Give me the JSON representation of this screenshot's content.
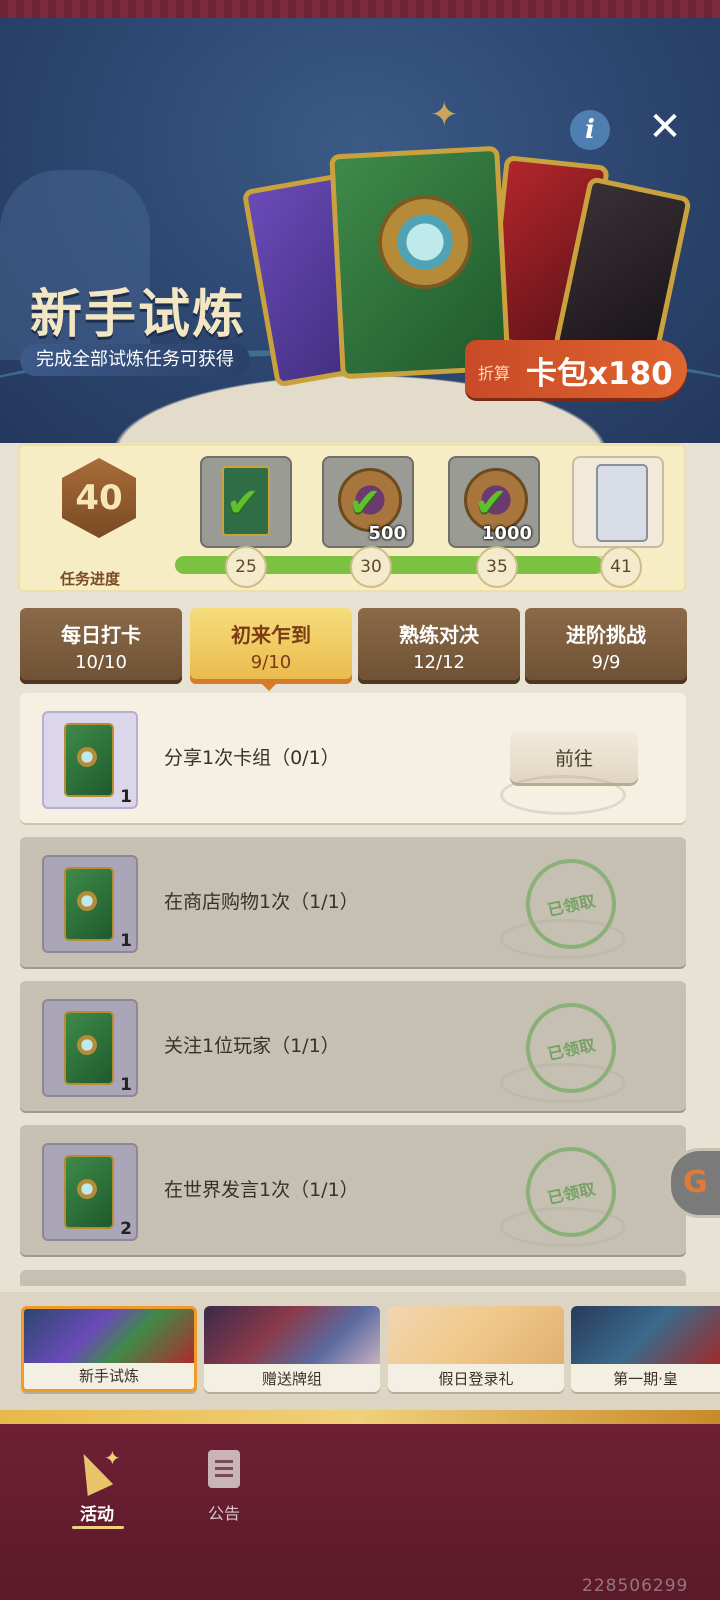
{
  "banner": {
    "title": "新手试炼",
    "subtitle": "完成全部试炼任务可获得",
    "reward_prefix": "折算",
    "reward_text": "卡包x180",
    "info_icon": "i"
  },
  "progress": {
    "value": "40",
    "label": "任务进度",
    "milestones": [
      {
        "threshold": "25",
        "reward": "card",
        "count": "",
        "claimed": true
      },
      {
        "threshold": "30",
        "reward": "medal",
        "count": "500",
        "claimed": true
      },
      {
        "threshold": "35",
        "reward": "medal",
        "count": "1000",
        "claimed": true
      },
      {
        "threshold": "41",
        "reward": "card",
        "count": "",
        "claimed": false
      }
    ],
    "fill_fraction": 0.93
  },
  "tabs": [
    {
      "label": "每日打卡",
      "count": "10/10",
      "active": false
    },
    {
      "label": "初来乍到",
      "count": "9/10",
      "active": true
    },
    {
      "label": "熟练对决",
      "count": "12/12",
      "active": false
    },
    {
      "label": "进阶挑战",
      "count": "9/9",
      "active": false
    }
  ],
  "tasks": [
    {
      "text": "分享1次卡组（0/1）",
      "qty": "1",
      "state": "open",
      "button": "前往"
    },
    {
      "text": "在商店购物1次（1/1）",
      "qty": "1",
      "state": "claimed",
      "stamp": "已领取"
    },
    {
      "text": "关注1位玩家（1/1）",
      "qty": "1",
      "state": "claimed",
      "stamp": "已领取"
    },
    {
      "text": "在世界发言1次（1/1）",
      "qty": "2",
      "state": "claimed",
      "stamp": "已领取"
    }
  ],
  "carousel": [
    {
      "caption": "新手试炼",
      "active": true
    },
    {
      "caption": "赠送牌组",
      "active": false
    },
    {
      "caption": "假日登录礼",
      "active": false
    },
    {
      "caption": "第一期·皇",
      "active": false
    }
  ],
  "nav": {
    "activity": "活动",
    "notice": "公告"
  },
  "watermark": "228506299",
  "icons": {
    "close": "close-icon",
    "info": "info-icon",
    "check": "check-icon",
    "notice": "document-icon",
    "activity": "party-popper-icon"
  },
  "colors": {
    "accent": "#e8b94a",
    "reward": "#e0642e",
    "progress_fill": "#7bc243",
    "nav_bg": "#6e2034"
  }
}
